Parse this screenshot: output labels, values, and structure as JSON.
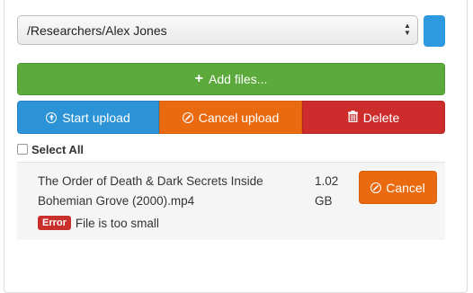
{
  "folder_select": {
    "value": "/Researchers/Alex Jones"
  },
  "buttons": {
    "add_files": "Add files...",
    "start_upload": "Start upload",
    "cancel_upload": "Cancel upload",
    "delete": "Delete"
  },
  "select_all_label": "Select All",
  "files": [
    {
      "name_line1": "The Order of Death & Dark Secrets Inside",
      "name_line2": "Bohemian Grove (2000).mp4",
      "size_line1": "1.02",
      "size_line2": "GB",
      "cancel_label": "Cancel",
      "error_badge": "Error",
      "error_message": "File is too small"
    }
  ],
  "colors": {
    "add": "#5caa3c",
    "start": "#2b93d6",
    "cancel": "#ea6a0f",
    "delete": "#cc2c2c",
    "error": "#c9302c"
  },
  "icons": {
    "add": "plus-icon",
    "start": "upload-circle-icon",
    "cancel": "ban-icon",
    "delete": "trash-icon"
  }
}
